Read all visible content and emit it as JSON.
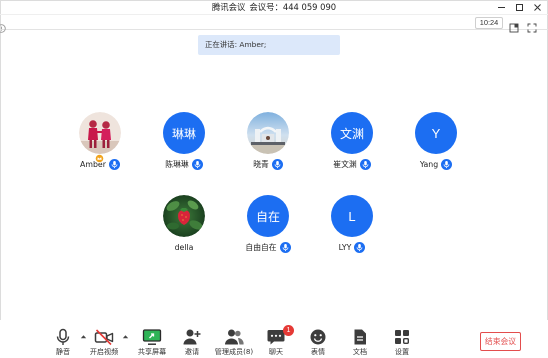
{
  "window": {
    "app_title": "腾讯会议",
    "meeting_id": "会议号：444 059 090",
    "controls": [
      "minimize-icon",
      "maximize-icon",
      "close-icon"
    ]
  },
  "top_bar": {
    "time": "10:24",
    "icons": [
      "status-icon",
      "layout-icon",
      "fullscreen-icon"
    ]
  },
  "speaking_banner": "正在讲话: Amber;",
  "participants": [
    {
      "name": "Amber",
      "mic_icon": "mic-icon",
      "badge_icon": "host-icon"
    },
    {
      "name": "陈琳琳",
      "avatar_text": "琳琳",
      "mic_icon": "mic-icon"
    },
    {
      "name": "晓青",
      "mic_icon": "mic-icon"
    },
    {
      "name": "崔文渊",
      "avatar_text": "文渊",
      "mic_icon": "mic-icon"
    },
    {
      "name": "Yang",
      "avatar_text": "Y",
      "mic_icon": "mic-icon"
    },
    {
      "name": "della"
    },
    {
      "name": "自由自在",
      "avatar_text": "自在",
      "mic_icon": "mic-icon"
    },
    {
      "name": "LYY",
      "avatar_text": "L",
      "mic_icon": "mic-icon"
    }
  ],
  "bottom_toolbar": {
    "items": [
      {
        "label": "静音",
        "icon": "microphone-icon"
      },
      {
        "label": "开启视频",
        "icon": "video-off-icon"
      },
      {
        "label": "共享屏幕",
        "icon": "share-screen-icon"
      },
      {
        "label": "邀请",
        "icon": "invite-icon"
      },
      {
        "label": "管理成员(8)",
        "icon": "members-icon"
      },
      {
        "label": "聊天",
        "icon": "chat-icon",
        "badge": "1"
      },
      {
        "label": "表情",
        "icon": "emoji-icon"
      },
      {
        "label": "文档",
        "icon": "document-icon"
      },
      {
        "label": "设置",
        "icon": "settings-icon"
      }
    ],
    "end_meeting_label": "结束会议"
  },
  "colors": {
    "accent": "#1c6ef2",
    "banner_bg": "#dce8fa",
    "end_meeting": "#e34d4d",
    "badge": "#e53935",
    "share_green": "#2fb457"
  }
}
